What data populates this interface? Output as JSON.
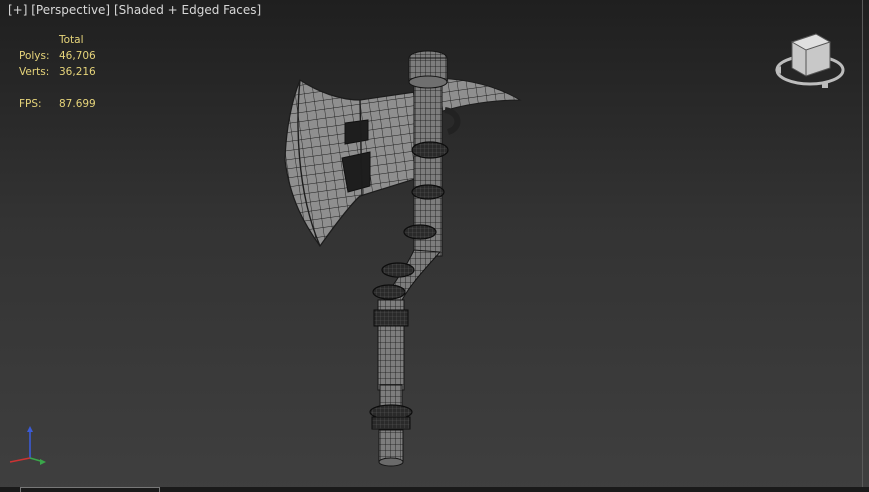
{
  "viewport": {
    "labels": {
      "plus": "[+]",
      "view": "[Perspective]",
      "shading": "[Shaded + Edged Faces]"
    },
    "stats": {
      "header": "Total",
      "polys_label": "Polys:",
      "polys_value": "46,706",
      "verts_label": "Verts:",
      "verts_value": "36,216",
      "fps_label": "FPS:",
      "fps_value": "87.699"
    }
  },
  "colors": {
    "stats_text": "#e6d47a",
    "label_text": "#d8d8d8",
    "mesh_fill": "#8f8f8f",
    "mesh_edge": "#1c1c1c",
    "wrap_dark": "#161616"
  },
  "icons": {
    "viewcube": "viewcube-icon",
    "axis": "axis-tripod-icon"
  }
}
